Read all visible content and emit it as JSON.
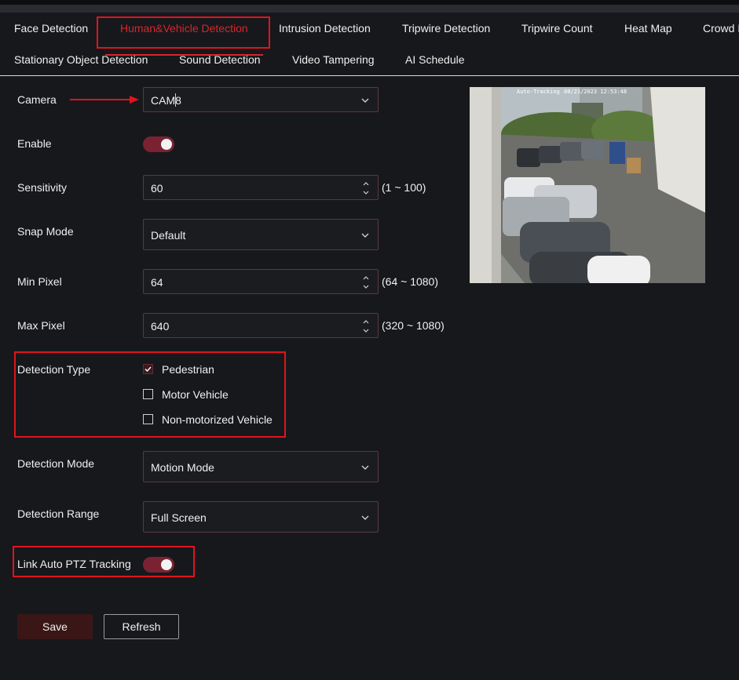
{
  "tabs": [
    {
      "label": "Face Detection",
      "active": false
    },
    {
      "label": "Human&Vehicle Detection",
      "active": true
    },
    {
      "label": "Intrusion Detection",
      "active": false
    },
    {
      "label": "Tripwire Detection",
      "active": false
    },
    {
      "label": "Tripwire Count",
      "active": false
    },
    {
      "label": "Heat Map",
      "active": false
    },
    {
      "label": "Crowd D",
      "active": false
    },
    {
      "label": "Stationary Object Detection",
      "active": false
    },
    {
      "label": "Sound Detection",
      "active": false
    },
    {
      "label": "Video Tampering",
      "active": false
    },
    {
      "label": "AI Schedule",
      "active": false
    }
  ],
  "form": {
    "camera": {
      "label": "Camera",
      "value": "CAM8"
    },
    "enable": {
      "label": "Enable",
      "on": true
    },
    "sensitivity": {
      "label": "Sensitivity",
      "value": "60",
      "range": "(1 ~ 100)"
    },
    "snap_mode": {
      "label": "Snap Mode",
      "value": "Default"
    },
    "min_pixel": {
      "label": "Min Pixel",
      "value": "64",
      "range": "(64 ~ 1080)"
    },
    "max_pixel": {
      "label": "Max Pixel",
      "value": "640",
      "range": "(320 ~ 1080)"
    },
    "detection_type": {
      "label": "Detection Type",
      "options": [
        {
          "label": "Pedestrian",
          "checked": true
        },
        {
          "label": "Motor Vehicle",
          "checked": false
        },
        {
          "label": "Non-motorized Vehicle",
          "checked": false
        }
      ]
    },
    "detection_mode": {
      "label": "Detection Mode",
      "value": "Motion Mode"
    },
    "detection_range": {
      "label": "Detection Range",
      "value": "Full Screen"
    },
    "ptz_tracking": {
      "label": "Link Auto PTZ Tracking",
      "on": true
    }
  },
  "buttons": {
    "save": "Save",
    "refresh": "Refresh"
  },
  "preview": {
    "overlay_left": "Auto-Tracking",
    "overlay_right": "08/21/2023 12:53:48"
  },
  "colors": {
    "accent": "#d9252a",
    "highlight": "#e0141c",
    "toggle_on": "#7a2232",
    "background": "#17181c"
  }
}
